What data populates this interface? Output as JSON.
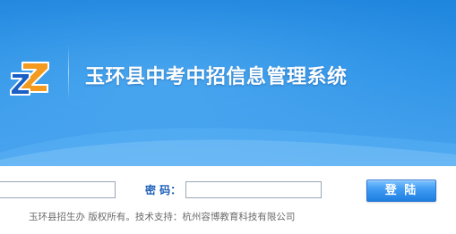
{
  "header": {
    "title": "玉环县中考中招信息管理系统",
    "logo_icon": "zz-logo-icon",
    "background_color": "#2d8fe6"
  },
  "login": {
    "username": {
      "value": "",
      "placeholder": ""
    },
    "password": {
      "label": "密 码：",
      "value": "",
      "placeholder": ""
    },
    "submit_label": "登 陆"
  },
  "footer": {
    "copyright": "玉环县招生办 版权所有。技术支持：杭州容博教育科技有限公司"
  },
  "colors": {
    "accent": "#1d5fb8",
    "button": "#3d9af3",
    "logo_orange": "#f39a1f",
    "logo_blue": "#1a5fc4"
  }
}
